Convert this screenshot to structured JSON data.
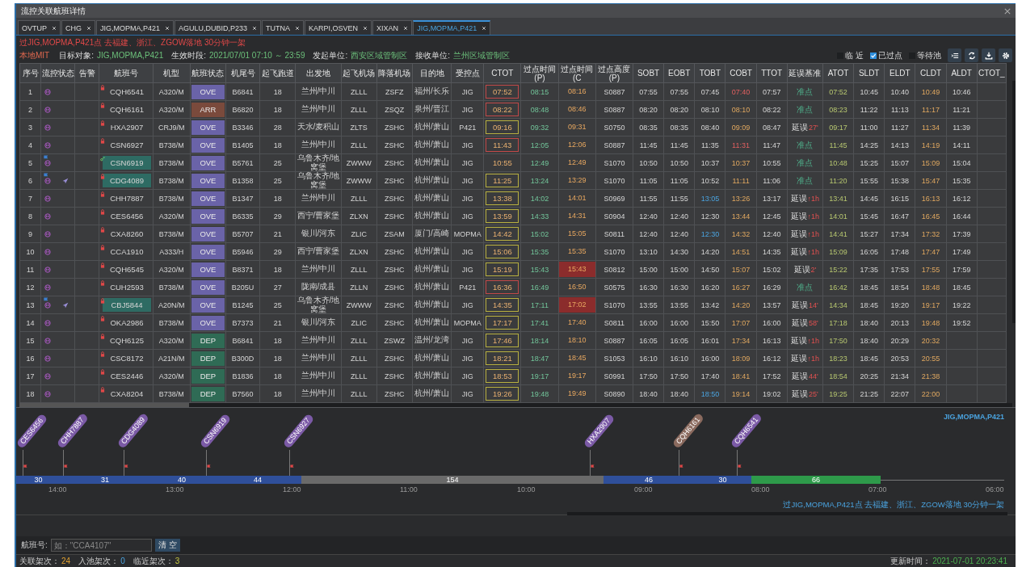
{
  "window": {
    "title": "流控关联航班详情"
  },
  "tabs": [
    {
      "label": "OVTUP",
      "selected": false
    },
    {
      "label": "CHG",
      "selected": false
    },
    {
      "label": "JIG,MOPMA,P421",
      "selected": false
    },
    {
      "label": "AGULU,DUBID,P233",
      "selected": false
    },
    {
      "label": "TUTNA",
      "selected": false
    },
    {
      "label": "KARPI,OSVEN",
      "selected": false
    },
    {
      "label": "XIXAN",
      "selected": false
    },
    {
      "label": "JIG,MOPMA,P421",
      "selected": true
    }
  ],
  "alert": "过JIG,MOPMA,P421点 去福建、浙江、ZGOW落地 30分钟一架",
  "info": {
    "mode": "本地MIT",
    "fields": [
      {
        "label": "目标对象:",
        "value": "JIG,MOPMA,P421"
      },
      {
        "label": "生效时段:",
        "value": "2021/07/01 07:10 ～ 23:59"
      },
      {
        "label": "发起单位:",
        "value": "西安区域管制区"
      },
      {
        "label": "接收单位:",
        "value": "兰州区域管制区"
      }
    ]
  },
  "filters": [
    {
      "label": "临 近",
      "checked": false
    },
    {
      "label": "已过点",
      "checked": true
    },
    {
      "label": "等待池",
      "checked": false
    }
  ],
  "columns": [
    "序号",
    "流控状态",
    "告警",
    "航班号",
    "机型",
    "航班状态",
    "机尾号",
    "起飞跑道",
    "出发地",
    "起飞机场",
    "降落机场",
    "目的地",
    "受控点",
    "CTOT",
    "过点时间(P)",
    "过点时间(C",
    "过点高度(P)",
    "SOBT",
    "EOBT",
    "TOBT",
    "COBT",
    "TTOT",
    "延误基准",
    "ATOT",
    "SLDT",
    "ELDT",
    "CLDT",
    "ALDT",
    "CTOT_"
  ],
  "rows": [
    {
      "seq": "1",
      "flight": "CQH6541",
      "locked": true,
      "highlight": false,
      "flag": false,
      "plane": false,
      "type": "A320/M",
      "status": {
        "label": "OVE",
        "kind": "overfly"
      },
      "reg": "B6841",
      "rwy": "18",
      "origin": "兰州/中川",
      "dep": "ZLLL",
      "arr": "ZSFZ",
      "dest": "福州/长乐",
      "fix": "JIG",
      "ctot": {
        "value": "07:52",
        "kind": "late"
      },
      "pass_p": "08:15",
      "pass_c": "08:16",
      "pass_c_alert": false,
      "alt": "S0887",
      "sobt": "07:55",
      "eobt": "07:55",
      "tobt": "07:45",
      "tobt_changed": false,
      "cobt": "07:40",
      "cobt_alert": true,
      "ttot": "07:57",
      "delay": "准点",
      "delayed": false,
      "atot": "07:52",
      "sldt": "10:45",
      "eldt": "10:40",
      "cldt": "10:49",
      "aldt": "10:46"
    },
    {
      "seq": "2",
      "flight": "CQH6161",
      "locked": true,
      "highlight": false,
      "flag": false,
      "plane": false,
      "type": "A320/M",
      "status": {
        "label": "ARR",
        "kind": "arrival"
      },
      "reg": "B6820",
      "rwy": "18",
      "origin": "兰州/中川",
      "dep": "ZLLL",
      "arr": "ZSQZ",
      "dest": "泉州/晋江",
      "fix": "JIG",
      "ctot": {
        "value": "08:22",
        "kind": "late"
      },
      "pass_p": "08:48",
      "pass_c": "08:46",
      "pass_c_alert": false,
      "alt": "S0887",
      "sobt": "08:20",
      "eobt": "08:20",
      "tobt": "08:10",
      "tobt_changed": false,
      "cobt": "08:10",
      "cobt_alert": false,
      "ttot": "08:22",
      "delay": "准点",
      "delayed": false,
      "atot": "08:23",
      "sldt": "11:22",
      "eldt": "11:13",
      "cldt": "11:17",
      "aldt": "11:21"
    },
    {
      "seq": "3",
      "flight": "HXA2907",
      "locked": true,
      "highlight": false,
      "flag": false,
      "plane": false,
      "type": "CRJ9/M",
      "status": {
        "label": "OVE",
        "kind": "overfly"
      },
      "reg": "B3346",
      "rwy": "28",
      "origin": "天水/麦积山",
      "dep": "ZLTS",
      "arr": "ZSHC",
      "dest": "杭州/萧山",
      "fix": "P421",
      "ctot": {
        "value": "09:16",
        "kind": "warn"
      },
      "pass_p": "09:32",
      "pass_c": "09:31",
      "pass_c_alert": false,
      "alt": "S0750",
      "sobt": "08:35",
      "eobt": "08:35",
      "tobt": "08:40",
      "tobt_changed": false,
      "cobt": "09:09",
      "cobt_alert": false,
      "ttot": "08:47",
      "delay": "延误",
      "delayed": true,
      "delay_note": "27'",
      "atot": "09:17",
      "sldt": "11:00",
      "eldt": "11:27",
      "cldt": "11:34",
      "aldt": "11:39"
    },
    {
      "seq": "4",
      "flight": "CSN6927",
      "locked": true,
      "highlight": false,
      "flag": false,
      "plane": false,
      "type": "B738/M",
      "status": {
        "label": "OVE",
        "kind": "overfly"
      },
      "reg": "B1405",
      "rwy": "18",
      "origin": "兰州/中川",
      "dep": "ZLLL",
      "arr": "ZSHC",
      "dest": "杭州/萧山",
      "fix": "JIG",
      "ctot": {
        "value": "11:43",
        "kind": "late"
      },
      "pass_p": "12:05",
      "pass_c": "12:06",
      "pass_c_alert": false,
      "alt": "S0887",
      "sobt": "11:45",
      "eobt": "11:45",
      "tobt": "11:35",
      "tobt_changed": false,
      "cobt": "11:31",
      "cobt_alert": true,
      "ttot": "11:47",
      "delay": "准点",
      "delayed": false,
      "atot": "11:45",
      "sldt": "14:25",
      "eldt": "14:13",
      "cldt": "14:19",
      "aldt": "14:11"
    },
    {
      "seq": "5",
      "flight": "CSN6919",
      "locked": false,
      "highlight": true,
      "flag": true,
      "plane": false,
      "type": "B738/M",
      "status": {
        "label": "OVE",
        "kind": "overfly"
      },
      "reg": "B5761",
      "rwy": "25",
      "origin": "乌鲁木齐/地窝堡",
      "dep": "ZWWW",
      "arr": "ZSHC",
      "dest": "杭州/萧山",
      "fix": "JIG",
      "ctot": {
        "value": "10:55",
        "kind": "plain"
      },
      "pass_p": "12:49",
      "pass_c": "12:49",
      "pass_c_alert": false,
      "alt": "S1070",
      "sobt": "10:50",
      "eobt": "10:50",
      "tobt": "10:37",
      "tobt_changed": false,
      "cobt": "10:37",
      "cobt_alert": false,
      "ttot": "10:55",
      "delay": "准点",
      "delayed": false,
      "atot": "10:48",
      "sldt": "15:25",
      "eldt": "15:07",
      "cldt": "15:09",
      "aldt": "15:04"
    },
    {
      "seq": "6",
      "flight": "CDG4089",
      "locked": true,
      "highlight": true,
      "flag": true,
      "plane": true,
      "type": "B738/M",
      "status": {
        "label": "OVE",
        "kind": "overfly"
      },
      "reg": "B1358",
      "rwy": "25",
      "origin": "乌鲁木齐/地窝堡",
      "dep": "ZWWW",
      "arr": "ZSHC",
      "dest": "杭州/萧山",
      "fix": "JIG",
      "ctot": {
        "value": "11:25",
        "kind": "warn"
      },
      "pass_p": "13:24",
      "pass_c": "13:29",
      "pass_c_alert": false,
      "alt": "S1070",
      "sobt": "11:05",
      "eobt": "11:05",
      "tobt": "10:52",
      "tobt_changed": false,
      "cobt": "11:11",
      "cobt_alert": false,
      "ttot": "11:06",
      "delay": "准点",
      "delayed": false,
      "atot": "11:20",
      "sldt": "15:55",
      "eldt": "15:38",
      "cldt": "15:47",
      "aldt": "15:35"
    },
    {
      "seq": "7",
      "flight": "CHH7887",
      "locked": true,
      "highlight": false,
      "flag": false,
      "plane": false,
      "type": "B738/M",
      "status": {
        "label": "OVE",
        "kind": "overfly"
      },
      "reg": "B1347",
      "rwy": "18",
      "origin": "兰州/中川",
      "dep": "ZLLL",
      "arr": "ZSHC",
      "dest": "杭州/萧山",
      "fix": "JIG",
      "ctot": {
        "value": "13:38",
        "kind": "warn"
      },
      "pass_p": "14:02",
      "pass_c": "14:01",
      "pass_c_alert": false,
      "alt": "S0969",
      "sobt": "11:55",
      "eobt": "11:55",
      "tobt": "13:05",
      "tobt_changed": true,
      "cobt": "13:26",
      "cobt_alert": false,
      "ttot": "13:17",
      "delay": "延误",
      "delayed": true,
      "delay_note": "↑1h",
      "atot": "13:41",
      "sldt": "14:45",
      "eldt": "16:15",
      "cldt": "16:13",
      "aldt": "16:12"
    },
    {
      "seq": "8",
      "flight": "CES6456",
      "locked": true,
      "highlight": false,
      "flag": false,
      "plane": false,
      "type": "A320/M",
      "status": {
        "label": "OVE",
        "kind": "overfly"
      },
      "reg": "B6335",
      "rwy": "29",
      "origin": "西宁/曹家堡",
      "dep": "ZLXN",
      "arr": "ZSHC",
      "dest": "杭州/萧山",
      "fix": "JIG",
      "ctot": {
        "value": "13:59",
        "kind": "warn"
      },
      "pass_p": "14:33",
      "pass_c": "14:31",
      "pass_c_alert": false,
      "alt": "S0904",
      "sobt": "12:40",
      "eobt": "12:40",
      "tobt": "12:30",
      "tobt_changed": false,
      "cobt": "13:44",
      "cobt_alert": false,
      "ttot": "12:45",
      "delay": "延误",
      "delayed": true,
      "delay_note": "↑1h",
      "atot": "14:01",
      "sldt": "15:45",
      "eldt": "16:47",
      "cldt": "16:45",
      "aldt": "16:44"
    },
    {
      "seq": "9",
      "flight": "CXA8260",
      "locked": true,
      "highlight": false,
      "flag": false,
      "plane": false,
      "type": "B738/M",
      "status": {
        "label": "OVE",
        "kind": "overfly"
      },
      "reg": "B5707",
      "rwy": "21",
      "origin": "银川/河东",
      "dep": "ZLIC",
      "arr": "ZSAM",
      "dest": "厦门/高崎",
      "fix": "MOPMA",
      "ctot": {
        "value": "14:42",
        "kind": "warn"
      },
      "pass_p": "15:02",
      "pass_c": "15:05",
      "pass_c_alert": false,
      "alt": "S0811",
      "sobt": "12:40",
      "eobt": "12:40",
      "tobt": "12:30",
      "tobt_changed": true,
      "cobt": "14:32",
      "cobt_alert": false,
      "ttot": "12:40",
      "delay": "延误",
      "delayed": true,
      "delay_note": "↑1h",
      "atot": "14:41",
      "sldt": "15:27",
      "eldt": "17:34",
      "cldt": "17:32",
      "aldt": "17:39"
    },
    {
      "seq": "10",
      "flight": "CCA1910",
      "locked": true,
      "highlight": false,
      "flag": false,
      "plane": false,
      "type": "A333/H",
      "status": {
        "label": "OVE",
        "kind": "overfly"
      },
      "reg": "B5946",
      "rwy": "29",
      "origin": "西宁/曹家堡",
      "dep": "ZLXN",
      "arr": "ZSHC",
      "dest": "杭州/萧山",
      "fix": "JIG",
      "ctot": {
        "value": "15:06",
        "kind": "warn"
      },
      "pass_p": "15:35",
      "pass_c": "15:35",
      "pass_c_alert": false,
      "alt": "S1070",
      "sobt": "13:10",
      "eobt": "14:30",
      "tobt": "14:20",
      "tobt_changed": false,
      "cobt": "14:51",
      "cobt_alert": false,
      "ttot": "14:35",
      "delay": "延误",
      "delayed": true,
      "delay_note": "↑1h",
      "atot": "15:09",
      "sldt": "16:05",
      "eldt": "17:48",
      "cldt": "17:47",
      "aldt": "17:49"
    },
    {
      "seq": "11",
      "flight": "CQH6545",
      "locked": true,
      "highlight": false,
      "flag": false,
      "plane": false,
      "type": "A320/M",
      "status": {
        "label": "OVE",
        "kind": "overfly"
      },
      "reg": "B8371",
      "rwy": "18",
      "origin": "兰州/中川",
      "dep": "ZLLL",
      "arr": "ZSHC",
      "dest": "杭州/萧山",
      "fix": "JIG",
      "ctot": {
        "value": "15:19",
        "kind": "warn"
      },
      "pass_p": "15:43",
      "pass_c": "15:43",
      "pass_c_alert": true,
      "alt": "S0812",
      "sobt": "15:00",
      "eobt": "15:00",
      "tobt": "14:50",
      "tobt_changed": false,
      "cobt": "15:07",
      "cobt_alert": false,
      "ttot": "15:02",
      "delay": "延误",
      "delayed": true,
      "delay_note": "2'",
      "atot": "15:22",
      "sldt": "17:35",
      "eldt": "17:53",
      "cldt": "17:55",
      "aldt": "17:59"
    },
    {
      "seq": "12",
      "flight": "CUH2593",
      "locked": true,
      "highlight": false,
      "flag": false,
      "plane": false,
      "type": "B738/M",
      "status": {
        "label": "OVE",
        "kind": "overfly"
      },
      "reg": "B205U",
      "rwy": "27",
      "origin": "陇南/成县",
      "dep": "ZLLN",
      "arr": "ZSHC",
      "dest": "杭州/萧山",
      "fix": "P421",
      "ctot": {
        "value": "16:36",
        "kind": "late"
      },
      "pass_p": "16:49",
      "pass_c": "16:50",
      "pass_c_alert": false,
      "alt": "S0575",
      "sobt": "16:30",
      "eobt": "16:30",
      "tobt": "16:20",
      "tobt_changed": false,
      "cobt": "16:27",
      "cobt_alert": false,
      "ttot": "16:29",
      "delay": "准点",
      "delayed": false,
      "atot": "16:42",
      "sldt": "18:45",
      "eldt": "18:54",
      "cldt": "18:48",
      "aldt": "18:45"
    },
    {
      "seq": "13",
      "flight": "CBJ5844",
      "locked": true,
      "highlight": true,
      "flag": true,
      "plane": true,
      "type": "A20N/M",
      "status": {
        "label": "OVE",
        "kind": "overfly"
      },
      "reg": "B1245",
      "rwy": "25",
      "origin": "乌鲁木齐/地窝堡",
      "dep": "ZWWW",
      "arr": "ZSHC",
      "dest": "杭州/萧山",
      "fix": "JIG",
      "ctot": {
        "value": "14:35",
        "kind": "warn"
      },
      "pass_p": "17:11",
      "pass_c": "17:02",
      "pass_c_alert": true,
      "alt": "S1070",
      "sobt": "13:55",
      "eobt": "13:55",
      "tobt": "13:42",
      "tobt_changed": false,
      "cobt": "14:20",
      "cobt_alert": false,
      "ttot": "13:57",
      "delay": "延误",
      "delayed": true,
      "delay_note": "14'",
      "atot": "14:34",
      "sldt": "18:45",
      "eldt": "19:20",
      "cldt": "19:17",
      "aldt": "19:22"
    },
    {
      "seq": "14",
      "flight": "OKA2986",
      "locked": true,
      "highlight": false,
      "flag": false,
      "plane": false,
      "type": "B738/M",
      "status": {
        "label": "OVE",
        "kind": "overfly"
      },
      "reg": "B7373",
      "rwy": "21",
      "origin": "银川/河东",
      "dep": "ZLIC",
      "arr": "ZSHC",
      "dest": "杭州/萧山",
      "fix": "MOPMA",
      "ctot": {
        "value": "17:17",
        "kind": "warn"
      },
      "pass_p": "17:41",
      "pass_c": "17:40",
      "pass_c_alert": false,
      "alt": "S0811",
      "sobt": "16:00",
      "eobt": "16:00",
      "tobt": "15:50",
      "tobt_changed": false,
      "cobt": "17:07",
      "cobt_alert": false,
      "ttot": "16:00",
      "delay": "延误",
      "delayed": true,
      "delay_note": "58'",
      "atot": "17:18",
      "sldt": "18:40",
      "eldt": "20:13",
      "cldt": "19:48",
      "aldt": "19:52"
    },
    {
      "seq": "15",
      "flight": "CQH6125",
      "locked": true,
      "highlight": false,
      "flag": false,
      "plane": false,
      "type": "A320/M",
      "status": {
        "label": "DEP",
        "kind": "departure"
      },
      "reg": "B6841",
      "rwy": "18",
      "origin": "兰州/中川",
      "dep": "ZLLL",
      "arr": "ZSWZ",
      "dest": "温州/龙湾",
      "fix": "JIG",
      "ctot": {
        "value": "17:46",
        "kind": "warn"
      },
      "pass_p": "18:14",
      "pass_c": "18:10",
      "pass_c_alert": false,
      "alt": "S0887",
      "sobt": "16:05",
      "eobt": "16:05",
      "tobt": "16:01",
      "tobt_changed": false,
      "cobt": "17:34",
      "cobt_alert": false,
      "ttot": "16:13",
      "delay": "延误",
      "delayed": true,
      "delay_note": "↑1h",
      "atot": "17:50",
      "sldt": "18:40",
      "eldt": "20:29",
      "cldt": "20:32"
    },
    {
      "seq": "16",
      "flight": "CSC8172",
      "locked": true,
      "highlight": false,
      "flag": false,
      "plane": false,
      "type": "A21N/M",
      "status": {
        "label": "DEP",
        "kind": "departure"
      },
      "reg": "B300D",
      "rwy": "18",
      "origin": "兰州/中川",
      "dep": "ZLLL",
      "arr": "ZSHC",
      "dest": "杭州/萧山",
      "fix": "JIG",
      "ctot": {
        "value": "18:21",
        "kind": "warn"
      },
      "pass_p": "18:47",
      "pass_c": "18:45",
      "pass_c_alert": false,
      "alt": "S1053",
      "sobt": "16:10",
      "eobt": "16:10",
      "tobt": "16:00",
      "tobt_changed": false,
      "cobt": "18:09",
      "cobt_alert": false,
      "ttot": "16:12",
      "delay": "延误",
      "delayed": true,
      "delay_note": "↑1h",
      "atot": "18:23",
      "sldt": "18:45",
      "eldt": "20:53",
      "cldt": "20:55"
    },
    {
      "seq": "17",
      "flight": "CES2446",
      "locked": true,
      "highlight": false,
      "flag": false,
      "plane": false,
      "type": "A320/M",
      "status": {
        "label": "DEP",
        "kind": "departure"
      },
      "reg": "B1836",
      "rwy": "18",
      "origin": "兰州/中川",
      "dep": "ZLLL",
      "arr": "ZSHC",
      "dest": "杭州/萧山",
      "fix": "JIG",
      "ctot": {
        "value": "18:53",
        "kind": "warn"
      },
      "pass_p": "19:17",
      "pass_c": "19:17",
      "pass_c_alert": false,
      "alt": "S0991",
      "sobt": "17:50",
      "eobt": "17:50",
      "tobt": "17:40",
      "tobt_changed": false,
      "cobt": "18:41",
      "cobt_alert": false,
      "ttot": "17:52",
      "delay": "延误",
      "delayed": true,
      "delay_note": "44'",
      "atot": "18:54",
      "sldt": "20:25",
      "eldt": "21:34",
      "cldt": "21:38"
    },
    {
      "seq": "18",
      "flight": "CXA8204",
      "locked": true,
      "highlight": false,
      "flag": false,
      "plane": false,
      "type": "B738/M",
      "status": {
        "label": "DEP",
        "kind": "departure"
      },
      "reg": "B7560",
      "rwy": "18",
      "origin": "兰州/中川",
      "dep": "ZLLL",
      "arr": "ZSHC",
      "dest": "杭州/萧山",
      "fix": "JIG",
      "ctot": {
        "value": "19:26",
        "kind": "warn"
      },
      "pass_p": "19:48",
      "pass_c": "19:49",
      "pass_c_alert": false,
      "alt": "S0890",
      "sobt": "18:40",
      "eobt": "18:40",
      "tobt": "18:50",
      "tobt_changed": true,
      "cobt": "19:14",
      "cobt_alert": false,
      "ttot": "19:02",
      "delay": "延误",
      "delayed": true,
      "delay_note": "25'",
      "atot": "19:25",
      "sldt": "21:25",
      "eldt": "22:07",
      "cldt": "22:00"
    }
  ],
  "timeline": {
    "title": "JIG,MOPMA,P421",
    "tags": [
      {
        "flight": "CES6456",
        "color": "#7b5aa6"
      },
      {
        "flight": "CHH7887",
        "color": "#7b5aa6"
      },
      {
        "flight": "CDG4089",
        "color": "#7b5aa6"
      },
      {
        "flight": "CSN6919",
        "color": "#7b5aa6"
      },
      {
        "flight": "CSN6927",
        "color": "#7b5aa6"
      },
      {
        "flight": "HXA2907",
        "color": "#7b5aa6"
      },
      {
        "flight": "CQH6161",
        "color": "#8a6a5e"
      },
      {
        "flight": "CQH6541",
        "color": "#7b5aa6"
      }
    ],
    "segments": [
      {
        "label": "30",
        "kind": "busy"
      },
      {
        "label": "31",
        "kind": "busy"
      },
      {
        "label": "40",
        "kind": "busy"
      },
      {
        "label": "44",
        "kind": "busy"
      },
      {
        "label": "154",
        "kind": "idle"
      },
      {
        "label": "46",
        "kind": "busy"
      },
      {
        "label": "30",
        "kind": "busy"
      },
      {
        "label": "66",
        "kind": "free"
      }
    ],
    "ticks": [
      "14:00",
      "13:00",
      "12:00",
      "11:00",
      "10:00",
      "09:00",
      "08:00",
      "07:00",
      "06:00"
    ],
    "note": "过JIG,MOPMA,P421点 去福建、浙江、ZGOW落地 30分钟一架"
  },
  "search": {
    "label": "航班号:",
    "placeholder": "如：\"CCA4107\"",
    "button": "清 空"
  },
  "status_bar": {
    "counts": [
      {
        "label": "关联架次：",
        "value": "24",
        "kind": "total"
      },
      {
        "label": "入池架次：",
        "value": "0",
        "kind": "pool"
      },
      {
        "label": "临近架次：",
        "value": "3",
        "kind": "near"
      }
    ],
    "updated_label": "更新时间：",
    "updated": "2021-07-01 20:23:41"
  }
}
